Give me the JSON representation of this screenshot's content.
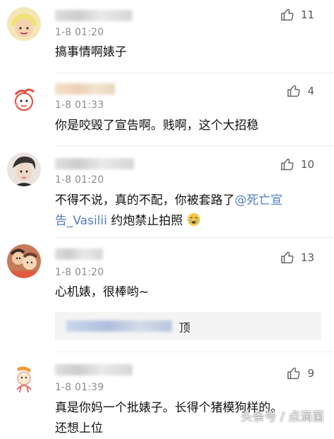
{
  "comments": [
    {
      "time": "1-8 01:20",
      "likes": "11",
      "text": "搞事情啊婊子"
    },
    {
      "time": "1-8 01:33",
      "likes": "4",
      "text": "你是咬毁了宣告啊。贱啊，这个大招稳"
    },
    {
      "time": "1-8 01:20",
      "likes": "10",
      "text_line1_prefix": "不得不说，真的不配，你被套路了",
      "mention": "@死亡宣告_Vasilii",
      "mention_line1": "@死亡宣",
      "mention_line2": "告_Vasilii",
      "text_line2_suffix": " 约炮禁止拍照"
    },
    {
      "time": "1-8 01:20",
      "likes": "13",
      "text": "心机婊，很棒哟~",
      "reply_text": "顶"
    },
    {
      "time": "1-8 01:39",
      "likes": "9",
      "text_line1": "真是你妈一个批婊子。长得个猪模狗样的。",
      "text_line2": "还想上位"
    }
  ],
  "watermark": "头条号 / 点滴菌",
  "colors": {
    "mention": "#4f7cc4",
    "time": "#8c8c8c",
    "reply_bg": "#f4f4f4"
  }
}
